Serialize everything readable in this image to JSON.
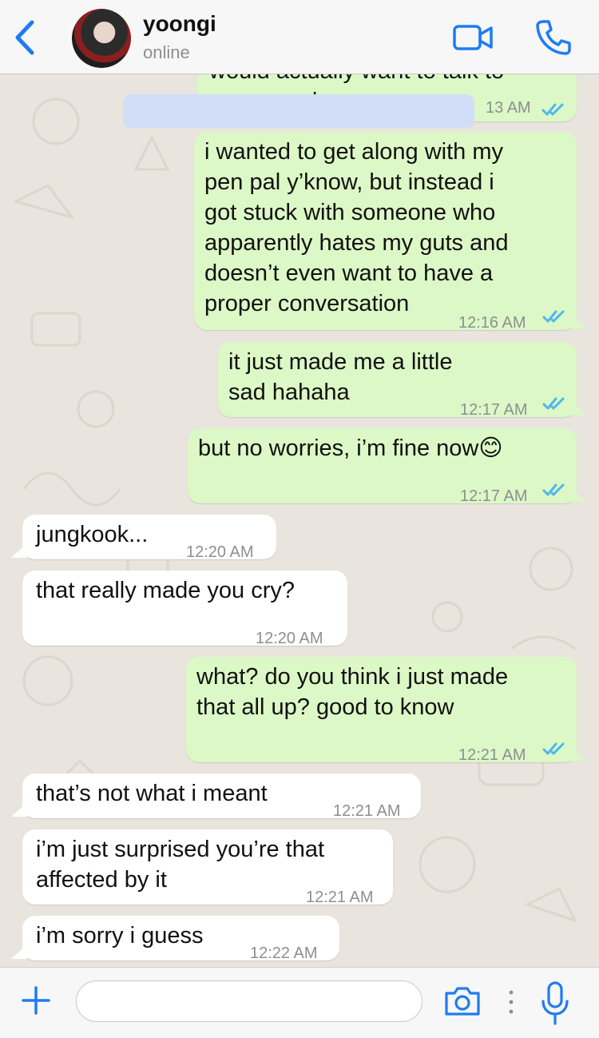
{
  "header": {
    "contact_name": "yoongi",
    "status": "online"
  },
  "messages": [
    {
      "side": "out",
      "text": "i wanted to get along with my\npen pal y’know, but instead i\ngot stuck with someone who\napparently hates my guts and\ndoesn’t even want to have a\nproper conversation",
      "time": "12:16 AM",
      "read": true
    },
    {
      "side": "out",
      "text": "it just made me a little\nsad hahaha",
      "time": "12:17 AM",
      "read": true
    },
    {
      "side": "out",
      "text": "but no worries, i’m fine now😊",
      "time": "12:17 AM",
      "read": true
    },
    {
      "side": "in",
      "text": "jungkook...",
      "time": "12:20 AM"
    },
    {
      "side": "in",
      "text": "that really made you cry?",
      "time": "12:20 AM"
    },
    {
      "side": "out",
      "text": "what? do you think i just made\nthat all up? good to know",
      "time": "12:21 AM",
      "read": true
    },
    {
      "side": "in",
      "text": "that’s not what i meant",
      "time": "12:21 AM"
    },
    {
      "side": "in",
      "text": "i’m just surprised you’re that\naffected by it",
      "time": "12:21 AM"
    },
    {
      "side": "in",
      "text": "i’m sorry i guess",
      "time": "12:22 AM"
    }
  ],
  "cutoff_message": {
    "text": "would actually want to talk to\nme everyday",
    "time": "13 AM",
    "read": true
  },
  "input": {
    "value": "",
    "placeholder": ""
  },
  "icons": {
    "back": "chevron-left-icon",
    "video": "video-camera-icon",
    "call": "phone-icon",
    "plus": "plus-icon",
    "camera": "camera-icon",
    "mic": "microphone-icon"
  },
  "colors": {
    "accent": "#1e7cf2",
    "outgoing_bubble": "#dcf8c6",
    "incoming_bubble": "#ffffff",
    "read_ticks": "#4fb7ec",
    "redaction": "#d2ddf8"
  }
}
